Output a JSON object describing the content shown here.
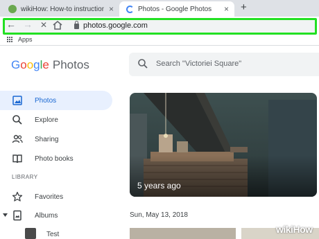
{
  "browser": {
    "tabs": [
      {
        "title": "wikiHow: How-to instructions yo",
        "active": false,
        "favicon": "wikihow-favicon"
      },
      {
        "title": "Photos - Google Photos",
        "active": true,
        "favicon": "google-photos-favicon"
      }
    ],
    "close_glyph": "×",
    "new_tab_glyph": "+",
    "back_glyph": "←",
    "forward_glyph": "→",
    "stop_glyph": "✕",
    "url": "photos.google.com",
    "highlight_color": "#22e022"
  },
  "bookmarks": {
    "apps_label": "Apps"
  },
  "header": {
    "logo_google": [
      "G",
      "o",
      "o",
      "g",
      "l",
      "e"
    ],
    "logo_photos": "Photos",
    "search_placeholder": "Search \"Victoriei Square\""
  },
  "sidebar": {
    "items": [
      {
        "label": "Photos",
        "icon": "photo-icon",
        "active": true
      },
      {
        "label": "Explore",
        "icon": "search-icon",
        "active": false
      },
      {
        "label": "Sharing",
        "icon": "people-icon",
        "active": false
      },
      {
        "label": "Photo books",
        "icon": "book-icon",
        "active": false
      }
    ],
    "library_heading": "LIBRARY",
    "library_items": [
      {
        "label": "Favorites",
        "icon": "star-icon"
      },
      {
        "label": "Albums",
        "icon": "album-icon",
        "expanded": true
      }
    ],
    "album_children": [
      {
        "label": "Test"
      }
    ]
  },
  "main": {
    "memory_label": "5 years ago",
    "date_heading": "Sun, May 13, 2018"
  },
  "watermark": {
    "part1": "wiki",
    "part2": "How"
  }
}
